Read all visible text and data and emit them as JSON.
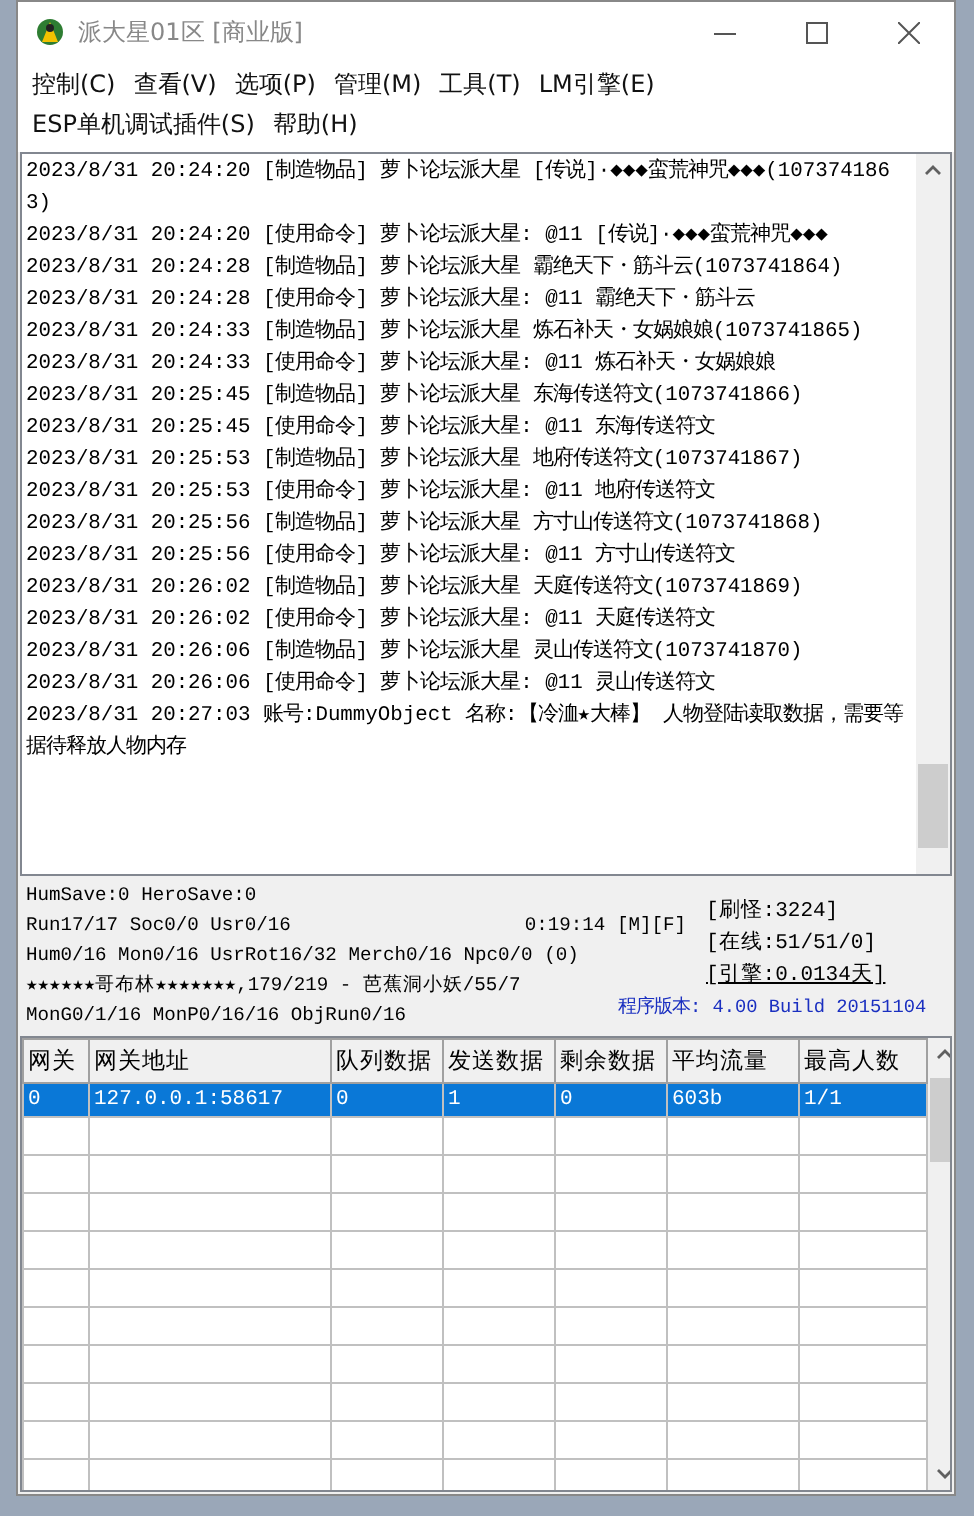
{
  "window": {
    "title": "派大星01区 [商业版]"
  },
  "menu_bar": {
    "items": [
      "控制(C)",
      "查看(V)",
      "选项(P)",
      "管理(M)",
      "工具(T)",
      "LM引擎(E)",
      "ESP单机调试插件(S)",
      "帮助(H)"
    ]
  },
  "log": {
    "lines": [
      "2023/8/31 20:24:20 [制造物品] 萝卜论坛派大星 [传说]·◆◆◆蛮荒神咒◆◆◆(1073741863)",
      "2023/8/31 20:24:20 [使用命令] 萝卜论坛派大星: @11 [传说]·◆◆◆蛮荒神咒◆◆◆",
      "2023/8/31 20:24:28 [制造物品] 萝卜论坛派大星 霸绝天下・筋斗云(1073741864)",
      "2023/8/31 20:24:28 [使用命令] 萝卜论坛派大星: @11 霸绝天下・筋斗云",
      "2023/8/31 20:24:33 [制造物品] 萝卜论坛派大星 炼石补天・女娲娘娘(1073741865)",
      "2023/8/31 20:24:33 [使用命令] 萝卜论坛派大星: @11 炼石补天・女娲娘娘",
      "2023/8/31 20:25:45 [制造物品] 萝卜论坛派大星 东海传送符文(1073741866)",
      "2023/8/31 20:25:45 [使用命令] 萝卜论坛派大星: @11 东海传送符文",
      "2023/8/31 20:25:53 [制造物品] 萝卜论坛派大星 地府传送符文(1073741867)",
      "2023/8/31 20:25:53 [使用命令] 萝卜论坛派大星: @11 地府传送符文",
      "2023/8/31 20:25:56 [制造物品] 萝卜论坛派大星 方寸山传送符文(1073741868)",
      "2023/8/31 20:25:56 [使用命令] 萝卜论坛派大星: @11 方寸山传送符文",
      "2023/8/31 20:26:02 [制造物品] 萝卜论坛派大星 天庭传送符文(1073741869)",
      "2023/8/31 20:26:02 [使用命令] 萝卜论坛派大星: @11 天庭传送符文",
      "2023/8/31 20:26:06 [制造物品] 萝卜论坛派大星 灵山传送符文(1073741870)",
      "2023/8/31 20:26:06 [使用命令] 萝卜论坛派大星: @11 灵山传送符文",
      "2023/8/31 20:27:03 账号:DummyObject 名称:【冷洫★大棒】 人物登陆读取数据，需要等据待释放人物内存"
    ]
  },
  "status": {
    "lines": [
      "HumSave:0 HeroSave:0",
      "Run17/17 Soc0/0 Usr0/16",
      "Hum0/16 Mon0/16 UsrRot16/32 Merch0/16 Npc0/0 (0)",
      "★★★★★★哥布林★★★★★★★,179/219 - 芭蕉洞小妖/55/7",
      "MonG0/1/16 MonP0/16/16 ObjRun0/16"
    ],
    "clock": "0:19:14 [M][F]",
    "counters": [
      "[刷怪:3224]",
      "[在线:51/51/0]",
      "[引擎:0.0134天]"
    ],
    "version": "程序版本: 4.00 Build 20151104"
  },
  "table": {
    "columns": [
      "网关",
      "网关地址",
      "队列数据",
      "发送数据",
      "剩余数据",
      "平均流量",
      "最高人数"
    ],
    "rows": [
      {
        "cells": [
          "0",
          "127.0.0.1:58617",
          "0",
          "1",
          "0",
          "603b",
          "1/1"
        ],
        "selected": true
      }
    ]
  }
}
